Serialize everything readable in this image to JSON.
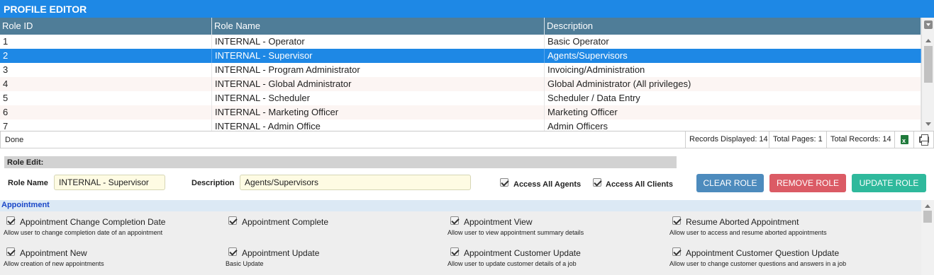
{
  "app": {
    "title": "PROFILE EDITOR"
  },
  "grid": {
    "headers": [
      "Role ID",
      "Role Name",
      "Description"
    ],
    "rows": [
      {
        "id": "1",
        "name": "INTERNAL - Operator",
        "description": "Basic Operator"
      },
      {
        "id": "2",
        "name": "INTERNAL - Supervisor",
        "description": "Agents/Supervisors"
      },
      {
        "id": "3",
        "name": "INTERNAL - Program Administrator",
        "description": "Invoicing/Administration"
      },
      {
        "id": "4",
        "name": "INTERNAL - Global Administrator",
        "description": "Global Administrator (All privileges)"
      },
      {
        "id": "5",
        "name": "INTERNAL - Scheduler",
        "description": "Scheduler / Data Entry"
      },
      {
        "id": "6",
        "name": "INTERNAL - Marketing Officer",
        "description": "Marketing Officer"
      },
      {
        "id": "7",
        "name": "INTERNAL - Admin Office",
        "description": "Admin Officers"
      }
    ],
    "selected_index": 1
  },
  "status": {
    "text": "Done",
    "records_displayed": "Records Displayed: 14",
    "total_pages": "Total Pages: 1",
    "total_records": "Total Records: 14",
    "icons": {
      "export": "excel-icon",
      "print": "printer-icon"
    }
  },
  "role_edit": {
    "heading": "Role Edit:",
    "role_name_label": "Role Name",
    "role_name_value": "INTERNAL - Supervisor",
    "description_label": "Description",
    "description_value": "Agents/Supervisors",
    "access_all_agents": "Access All Agents",
    "access_all_clients": "Access All Clients",
    "buttons": {
      "clear": "CLEAR ROLE",
      "remove": "REMOVE ROLE",
      "update": "UPDATE ROLE"
    }
  },
  "permissions": {
    "section": "Appointment",
    "items": [
      {
        "title": "Appointment Change Completion Date",
        "desc": "Allow user to change completion date of an appointment"
      },
      {
        "title": "Appointment Complete",
        "desc": ""
      },
      {
        "title": "Appointment View",
        "desc": "Allow user to view appointment summary details"
      },
      {
        "title": "Resume Aborted Appointment",
        "desc": "Allow user to access and resume aborted appointments"
      },
      {
        "title": "Appointment New",
        "desc": "Allow creation of new appointments"
      },
      {
        "title": "Appointment Update",
        "desc": "Basic Update"
      },
      {
        "title": "Appointment Customer Update",
        "desc": "Allow user to update customer details of a job"
      },
      {
        "title": "Appointment Customer Question Update",
        "desc": "Allow user to change customer questions and answers in a job"
      }
    ]
  },
  "colors": {
    "accent": "#1e88e5",
    "header": "#4f7d98",
    "clear": "#4d8bbd",
    "remove": "#db5b65",
    "update": "#2fb99c"
  }
}
